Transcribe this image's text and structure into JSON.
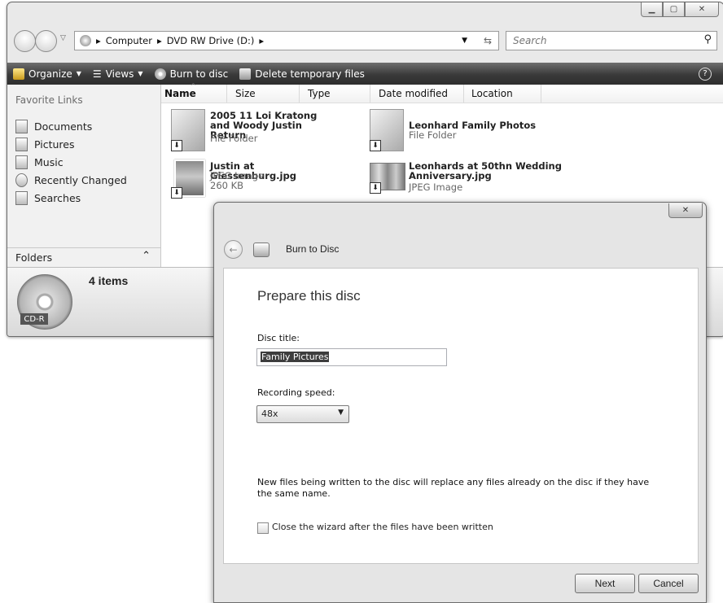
{
  "explorer": {
    "breadcrumb": [
      "Computer",
      "DVD RW Drive (D:)"
    ],
    "search_placeholder": "Search",
    "toolbar": {
      "organize": "Organize",
      "views": "Views",
      "burn": "Burn to disc",
      "delete_temp": "Delete temporary files"
    },
    "sidebar": {
      "heading": "Favorite Links",
      "items": [
        "Documents",
        "Pictures",
        "Music",
        "Recently Changed",
        "Searches"
      ],
      "folders_label": "Folders"
    },
    "columns": [
      "Name",
      "Size",
      "Type",
      "Date modified",
      "Location"
    ],
    "files": [
      {
        "name": "2005 11 Loi Kratong and Woody Justin Return",
        "type": "File Folder",
        "size": ""
      },
      {
        "name": "Leonhard Family Photos",
        "type": "File Folder",
        "size": ""
      },
      {
        "name": "Justin at Giessenburg.jpg",
        "type": "JPEG Image",
        "size": "260 KB"
      },
      {
        "name": "Leonhards at 50thn Wedding Anniversary.jpg",
        "type": "JPEG Image",
        "size": ""
      }
    ],
    "details": {
      "count": "4 items",
      "disc_label": "CD-R"
    }
  },
  "dialog": {
    "title": "Burn to Disc",
    "heading": "Prepare this disc",
    "disc_title_label": "Disc title:",
    "disc_title_value": "Family Pictures",
    "speed_label": "Recording speed:",
    "speed_value": "48x",
    "note": "New files being written to the disc will replace any files already on the disc if they have the same name.",
    "close_wizard_label": "Close the wizard after the files have been written",
    "next": "Next",
    "cancel": "Cancel"
  }
}
